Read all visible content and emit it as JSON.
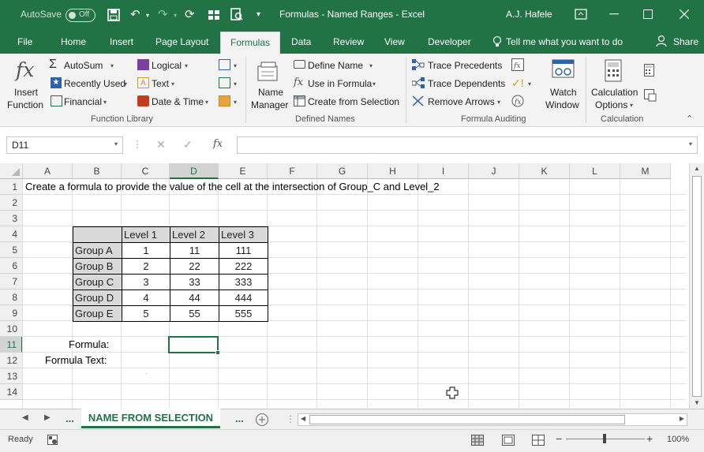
{
  "titlebar": {
    "autosave_label": "AutoSave",
    "autosave_state": "Off",
    "document_title": "Formulas - Named Ranges  -  Excel",
    "user_name": "A.J. Hafele"
  },
  "tabs": [
    "File",
    "Home",
    "Insert",
    "Page Layout",
    "Formulas",
    "Data",
    "Review",
    "View",
    "Developer"
  ],
  "active_tab": "Formulas",
  "tell_me": "Tell me what you want to do",
  "share_label": "Share",
  "ribbon": {
    "function_library": {
      "label": "Function Library",
      "insert_function": [
        "Insert",
        "Function"
      ],
      "autosum": "AutoSum",
      "recently_used": "Recently Used",
      "financial": "Financial",
      "logical": "Logical",
      "text": "Text",
      "date_time": "Date & Time"
    },
    "defined_names": {
      "label": "Defined Names",
      "name_manager": [
        "Name",
        "Manager"
      ],
      "define_name": "Define Name",
      "use_in_formula": "Use in Formula",
      "create_from_selection": "Create from Selection"
    },
    "formula_auditing": {
      "label": "Formula Auditing",
      "trace_precedents": "Trace Precedents",
      "trace_dependents": "Trace Dependents",
      "remove_arrows": "Remove Arrows",
      "watch_window": [
        "Watch",
        "Window"
      ]
    },
    "calculation": {
      "label": "Calculation",
      "calculation_options": [
        "Calculation",
        "Options"
      ]
    }
  },
  "formula_bar": {
    "name_box": "D11",
    "fx": "fx",
    "formula": ""
  },
  "columns": [
    "A",
    "B",
    "C",
    "D",
    "E",
    "F",
    "G",
    "H",
    "I",
    "J",
    "K",
    "L",
    "M"
  ],
  "rows": [
    "1",
    "2",
    "3",
    "4",
    "5",
    "6",
    "7",
    "8",
    "9",
    "10",
    "11",
    "12",
    "13",
    "14"
  ],
  "selected_cell": "D11",
  "sheet": {
    "instruction": "Create a formula to provide the value of the cell at the intersection of Group_C and Level_2",
    "table_header": [
      "",
      "Level 1",
      "Level 2",
      "Level 3"
    ],
    "table_rows": [
      [
        "Group A",
        "1",
        "11",
        "111"
      ],
      [
        "Group B",
        "2",
        "22",
        "222"
      ],
      [
        "Group C",
        "3",
        "33",
        "333"
      ],
      [
        "Group D",
        "4",
        "44",
        "444"
      ],
      [
        "Group E",
        "5",
        "55",
        "555"
      ]
    ],
    "formula_label": "Formula:",
    "formula_text_label": "Formula Text:"
  },
  "sheet_tabs": {
    "ellipsis_left": "...",
    "active": "NAME FROM SELECTION",
    "ellipsis_right": "..."
  },
  "status": {
    "ready": "Ready",
    "zoom": "100%"
  },
  "colors": {
    "accent": "#217346",
    "header_fill": "#d9d9d9"
  }
}
